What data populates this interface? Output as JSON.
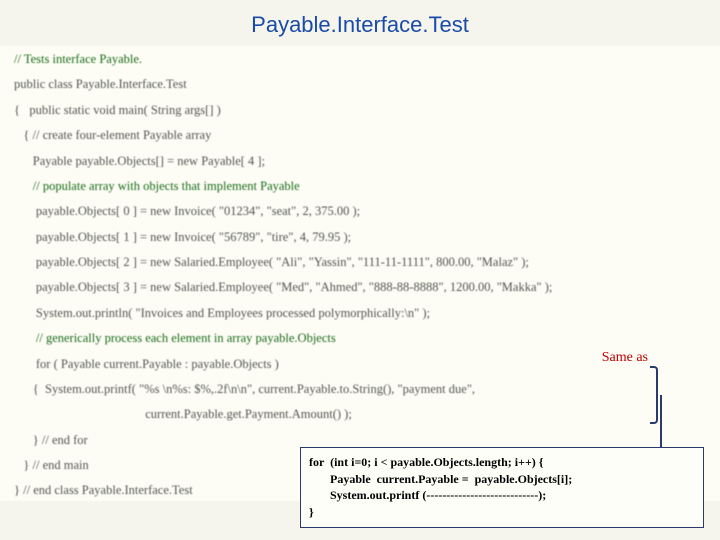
{
  "title": "Payable.Interface.Test",
  "code": {
    "l1": "// Tests interface Payable.",
    "l2": "public class Payable.Interface.Test",
    "l3": "{   public static void main( String args[] )",
    "l4": "   { // create four-element Payable array",
    "l5": "      Payable payable.Objects[] = new Payable[ 4 ];",
    "l6": "      // populate array with objects that implement Payable",
    "l7": "       payable.Objects[ 0 ] = new Invoice( \"01234\", \"seat\", 2, 375.00 );",
    "l8": "       payable.Objects[ 1 ] = new Invoice( \"56789\", \"tire\", 4, 79.95 );",
    "l9": "       payable.Objects[ 2 ] = new Salaried.Employee( \"Ali\", \"Yassin\", \"111-11-1111\", 800.00, \"Malaz\" );",
    "l10": "       payable.Objects[ 3 ] = new Salaried.Employee( \"Med\", \"Ahmed\", \"888-88-8888\", 1200.00, \"Makka\" );",
    "l11": "       System.out.println( \"Invoices and Employees processed polymorphically:\\n\" );",
    "l12": "       // generically process each element in array payable.Objects",
    "l13": "       for ( Payable current.Payable : payable.Objects )",
    "l14": "      {  System.out.printf( \"%s \\n%s: $%,.2f\\n\\n\", current.Payable.to.String(), \"payment due\",",
    "l15": "                                          current.Payable.get.Payment.Amount() );",
    "l16": "      } // end for",
    "l17": "   } // end main",
    "l18": "} // end class Payable.Interface.Test"
  },
  "annotation": {
    "same_as": "Same as"
  },
  "callout": {
    "c1": "for  (int i=0; i < payable.Objects.length; i++) {",
    "c2": "       Payable  current.Payable =  payable.Objects[i];",
    "c3": "       System.out.printf (----------------------------);",
    "c4": "}"
  }
}
